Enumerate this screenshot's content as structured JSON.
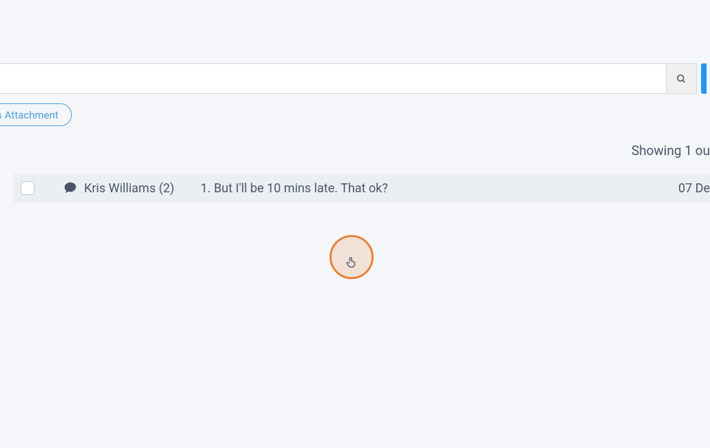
{
  "search": {
    "value": "",
    "placeholder": ""
  },
  "filter": {
    "attachment_label": "as Attachment"
  },
  "results": {
    "count_text": "Showing 1 ou"
  },
  "messages": [
    {
      "sender": "Kris Williams (2)",
      "preview": "1. But I'll be 10 mins late. That ok?",
      "date": "07 De"
    }
  ]
}
